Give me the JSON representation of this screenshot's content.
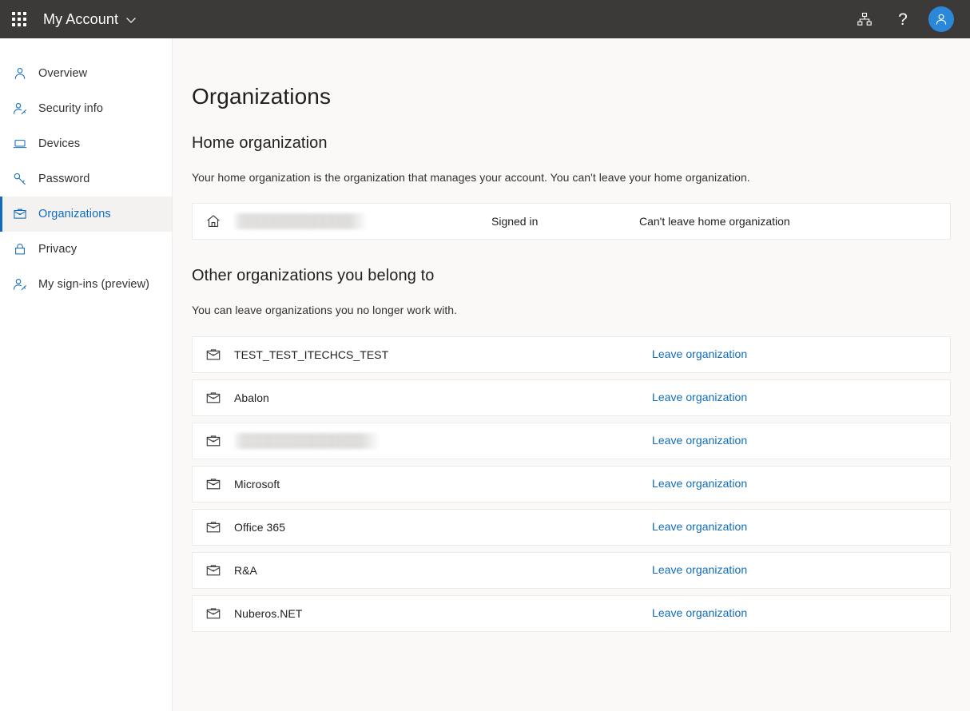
{
  "header": {
    "waffle_label": "app-launcher",
    "brand_title": "My Account",
    "icons": {
      "waffle": "waffle-grid-icon",
      "chevron": "chevron-down-icon",
      "org_hierarchy": "org-hierarchy-icon",
      "help": "?",
      "avatar": "user-avatar-icon"
    },
    "accent_color": "#2b88d8",
    "background_color": "#3b3a39"
  },
  "sidebar": {
    "items": [
      {
        "label": "Overview",
        "icon": "person-icon",
        "selected": false
      },
      {
        "label": "Security info",
        "icon": "person-key-icon",
        "selected": false
      },
      {
        "label": "Devices",
        "icon": "laptop-icon",
        "selected": false
      },
      {
        "label": "Password",
        "icon": "key-icon",
        "selected": false
      },
      {
        "label": "Organizations",
        "icon": "briefcase-icon",
        "selected": true
      },
      {
        "label": "Privacy",
        "icon": "lock-icon",
        "selected": false
      },
      {
        "label": "My sign-ins (preview)",
        "icon": "person-key-icon",
        "selected": false
      }
    ],
    "selected_color": "#0f6cbd"
  },
  "main": {
    "page_title": "Organizations",
    "home_section": {
      "title": "Home organization",
      "description": "Your home organization is the organization that manages your account. You can't leave your home organization.",
      "row": {
        "icon": "home-icon",
        "name": "",
        "name_redacted": true,
        "status": "Signed in",
        "action": "Can't leave home organization"
      }
    },
    "other_section": {
      "title": "Other organizations you belong to",
      "description": "You can leave organizations you no longer work with.",
      "leave_label": "Leave organization",
      "rows": [
        {
          "name": "TEST_TEST_ITECHCS_TEST",
          "redacted": false,
          "icon": "briefcase-icon"
        },
        {
          "name": "Abalon",
          "redacted": false,
          "icon": "briefcase-icon"
        },
        {
          "name": "",
          "redacted": true,
          "icon": "briefcase-icon"
        },
        {
          "name": "Microsoft",
          "redacted": false,
          "icon": "briefcase-icon"
        },
        {
          "name": "Office 365",
          "redacted": false,
          "icon": "briefcase-icon"
        },
        {
          "name": "R&A",
          "redacted": false,
          "icon": "briefcase-icon"
        },
        {
          "name": "Nuberos.NET",
          "redacted": false,
          "icon": "briefcase-icon"
        }
      ]
    },
    "link_color": "#0f6cbd",
    "background_color": "#faf9f8",
    "card_color": "#ffffff"
  }
}
